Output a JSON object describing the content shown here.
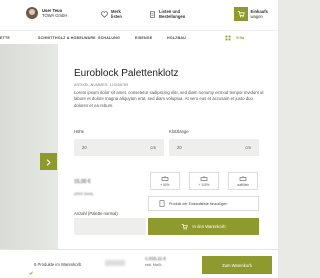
{
  "header": {
    "user_name": "User Teuo",
    "user_company": "TOWA GmbH",
    "watch_line1": "Merk",
    "watch_line2": "listen",
    "lists_line1": "Listen und",
    "lists_line2": "Bestellungen",
    "cart_line1": "Einkaufs",
    "cart_line2": "wagen"
  },
  "nav": {
    "items": [
      "ETTE",
      "SCHNITTHOLZ & HOBELWARE",
      "SCHALUNG",
      "EISENGE",
      "HOLZBAU"
    ],
    "right": "Villa"
  },
  "product": {
    "title": "Euroblock Palettenklotz",
    "article": "ARTIKEL-NUMMER: 123456789",
    "description": "Lorem ipsum dolor sit amet, consetetur sadipscing elitr, sed diam nonumy eirmod tempor invidunt ut labore et dolore magna aliquyam erat, sed diam voluptua. At vero eos et accusam et justo duo dolores et ea rebum.",
    "height_label": "Höhe",
    "height_value": "20",
    "height_unit": "cm",
    "length_label": "Klotzlänge",
    "length_value": "20",
    "length_unit": "cm",
    "price": "15,00 €",
    "price_sub": "(0000 Stück)",
    "qty_label": "Anzahl (Palette normal)",
    "compare_label": "Produkt der Einkaufsliste hinzufügen",
    "add_to_cart": "In den Warenkorb",
    "price_buttons": [
      "+ 50%",
      "+ 100%",
      "auffüllen"
    ]
  },
  "bottombar": {
    "count": "5 Produkte im Warenkorb",
    "total": "1.015,11 €",
    "total_sub": "exkl. MwSt.",
    "button": "Zum Warenkorb"
  },
  "colors": {
    "accent": "#8f9a2e"
  }
}
